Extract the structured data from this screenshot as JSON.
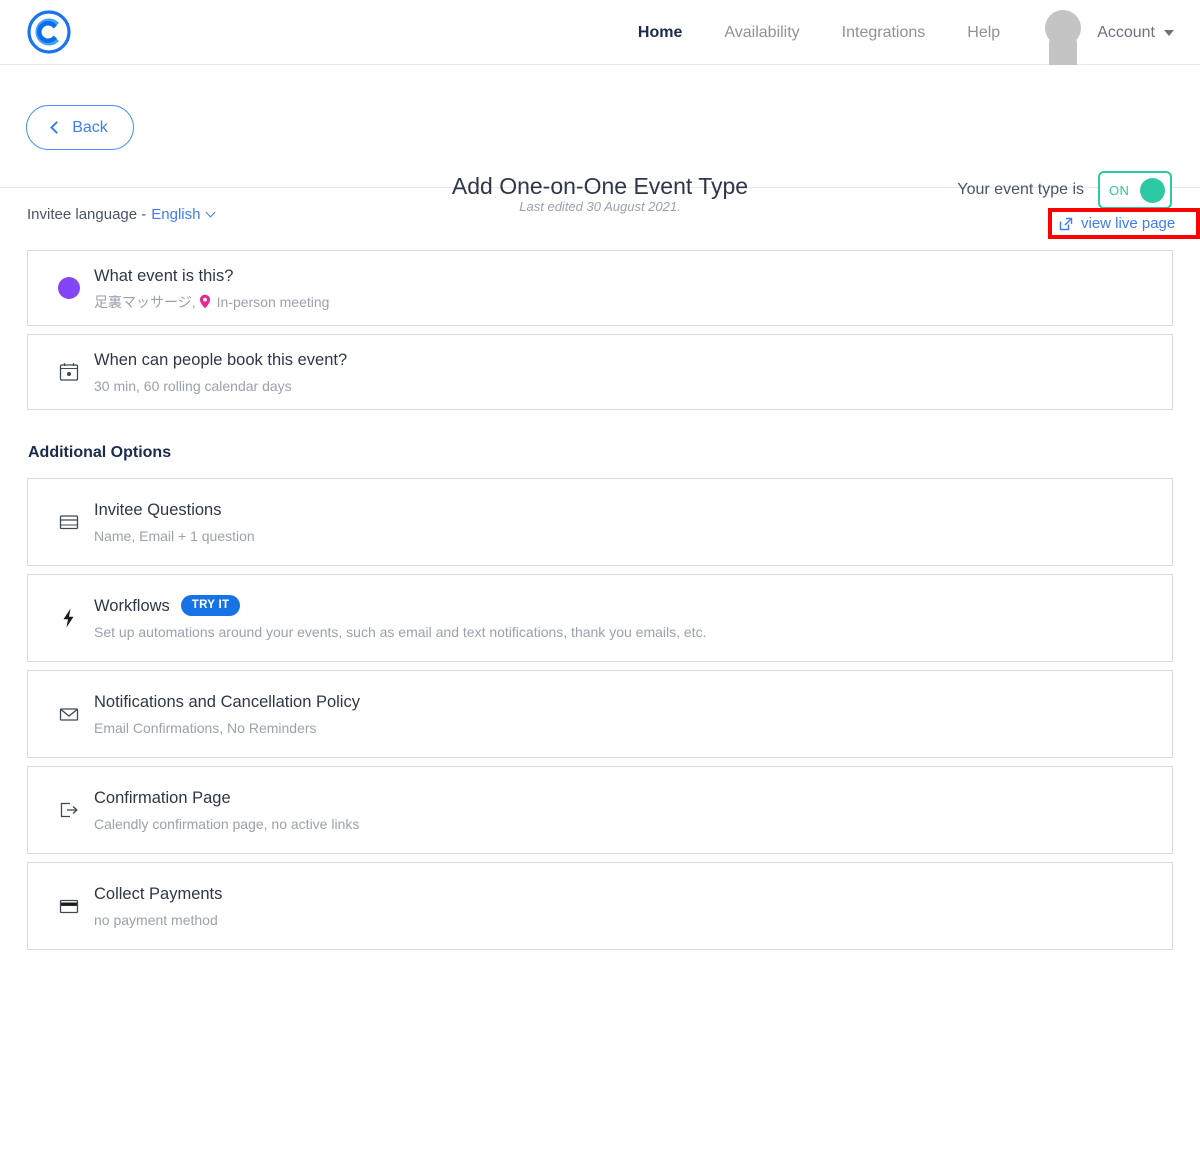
{
  "nav": {
    "logo_icon": "calendly-logo-icon",
    "links": [
      {
        "label": "Home",
        "active": true
      },
      {
        "label": "Availability",
        "active": false
      },
      {
        "label": "Integrations",
        "active": false
      },
      {
        "label": "Help",
        "active": false
      }
    ],
    "account_label": "Account",
    "account_caret_icon": "caret-down-icon",
    "avatar_icon": "default-user-avatar"
  },
  "subheader": {
    "back_label": "Back",
    "back_icon": "chevron-left-icon",
    "title": "Add One-on-One Event Type",
    "toggle_label": "Your event type is",
    "toggle_state": "ON",
    "toggle_color": "#2dc8a4"
  },
  "meta": {
    "language_label": "Invitee language -",
    "language_value": "English",
    "language_caret_icon": "chevron-down-icon",
    "last_edited": "Last edited 30 August 2021.",
    "live_page_label": "view live page",
    "live_page_icon": "external-link-icon",
    "highlight_color": "#ff0000"
  },
  "main_cards": [
    {
      "icon": "purple-circle-icon",
      "title": "What event is this?",
      "sub_prefix": "足裏マッサージ,",
      "sub_icon": "location-pin-icon",
      "sub_suffix": "In-person meeting"
    },
    {
      "icon": "calendar-icon",
      "title": "When can people book this event?",
      "sub": "30 min, 60 rolling calendar days"
    }
  ],
  "additional": {
    "heading": "Additional Options",
    "items": [
      {
        "icon": "form-card-icon",
        "title": "Invitee Questions",
        "sub": "Name, Email + 1 question",
        "badge": null
      },
      {
        "icon": "lightning-bolt-icon",
        "title": "Workflows",
        "badge": "TRY IT",
        "sub": "Set up automations around your events, such as email and text notifications, thank you emails, etc."
      },
      {
        "icon": "envelope-icon",
        "title": "Notifications and Cancellation Policy",
        "sub": "Email Confirmations, No Reminders",
        "badge": null
      },
      {
        "icon": "exit-arrow-icon",
        "title": "Confirmation Page",
        "sub": "Calendly confirmation page, no active links",
        "badge": null
      },
      {
        "icon": "credit-card-icon",
        "title": "Collect Payments",
        "sub": "no payment method",
        "badge": null
      }
    ]
  }
}
